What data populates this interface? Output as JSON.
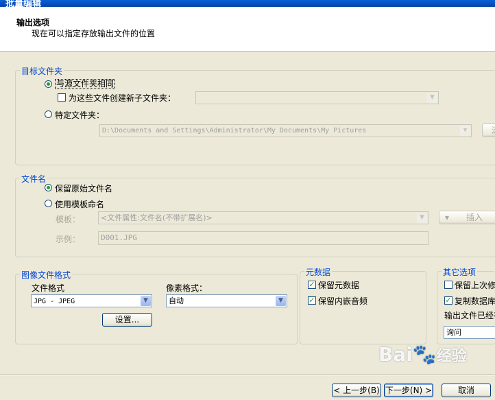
{
  "window": {
    "title": "批量编辑"
  },
  "header": {
    "title": "输出选项",
    "subtitle": "现在可以指定存放输出文件的位置"
  },
  "target_folder": {
    "legend": "目标文件夹",
    "same_as_source_label": "与源文件夹相同",
    "create_subfolder_label": "为这些文件创建新子文件夹：",
    "specific_folder_label": "特定文件夹：",
    "folder_path": "D:\\Documents and Settings\\Administrator\\My Documents\\My Pictures",
    "browse_label": "浏"
  },
  "filename": {
    "legend": "文件名",
    "keep_original_label": "保留原始文件名",
    "use_template_label": "使用模板命名",
    "template_label": "模板：",
    "template_value": "<文件属性:文件名(不带扩展名)>",
    "insert_label": "插入",
    "example_label": "示例：",
    "example_value": "D001.JPG"
  },
  "image_format": {
    "legend": "图像文件格式",
    "file_format_label": "文件格式",
    "file_format_value": "JPG - JPEG",
    "pixel_format_label": "像素格式：",
    "pixel_format_value": "自动",
    "settings_label": "设置..."
  },
  "metadata": {
    "legend": "元数据",
    "keep_metadata_label": "保留元数据",
    "keep_audio_label": "保留内嵌音频"
  },
  "other": {
    "legend": "其它选项",
    "keep_last_modified_label": "保留上次修",
    "copy_database_label": "复制数据库",
    "exists_label": "输出文件已经存",
    "exists_value": "询问"
  },
  "footer": {
    "back_label": "< 上一步(B)",
    "next_label": "下一步(N) >",
    "cancel_label": "取消"
  },
  "watermark": {
    "brand": "Bai",
    "suffix": "经验"
  },
  "colors": {
    "accent": "#0046d5",
    "check": "#21a121",
    "title_bar": "#0842a8"
  }
}
